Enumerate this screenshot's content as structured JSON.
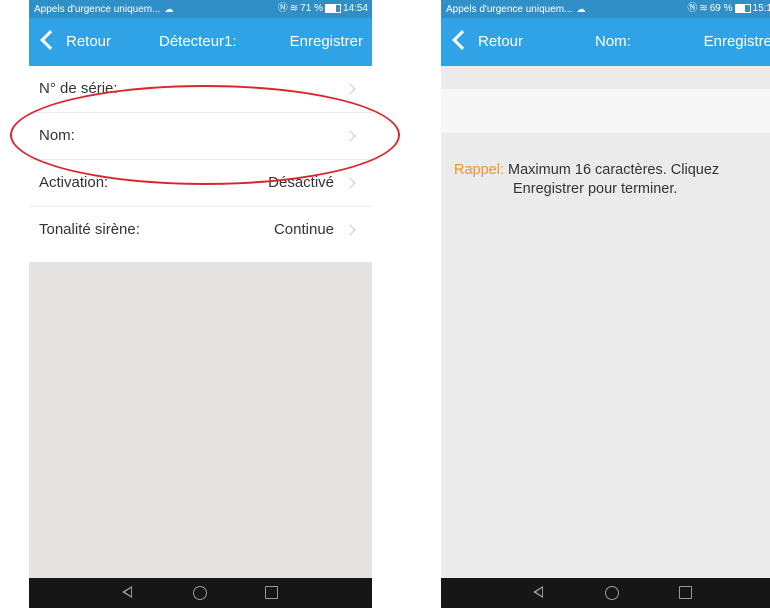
{
  "left": {
    "status": {
      "notification": "Appels d'urgence uniquem...",
      "battery": "71 %",
      "time": "14:54"
    },
    "nav": {
      "back_label": "Retour",
      "title": "Détecteur1:",
      "save_label": "Enregistrer"
    },
    "rows": [
      {
        "label": "N° de série:",
        "value": ""
      },
      {
        "label": "Nom:",
        "value": ""
      },
      {
        "label": "Activation:",
        "value": "Désactivé"
      },
      {
        "label": "Tonalité sirène:",
        "value": "Continue"
      }
    ]
  },
  "right": {
    "status": {
      "notification": "Appels d'urgence uniquem...",
      "battery": "69 %",
      "time": "15:1"
    },
    "nav": {
      "back_label": "Retour",
      "title": "Nom:",
      "save_label": "Enregistre"
    },
    "name_input": {
      "value": ""
    },
    "hint": {
      "label": "Rappel:",
      "line1": "Maximum 16 caractères. Cliquez",
      "line2": "Enregistrer pour terminer."
    }
  },
  "colors": {
    "status_bar": "#2f8fc6",
    "nav_bar": "#2fa3e6",
    "hint_label": "#f39321",
    "annotation": "#d9262c"
  }
}
